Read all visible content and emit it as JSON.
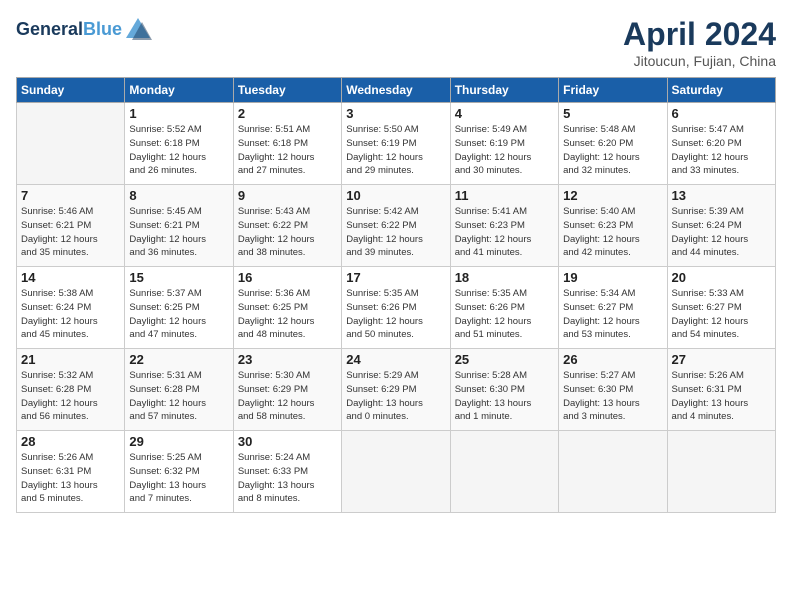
{
  "header": {
    "logo_line1": "General",
    "logo_line2": "Blue",
    "title": "April 2024",
    "subtitle": "Jitoucun, Fujian, China"
  },
  "weekdays": [
    "Sunday",
    "Monday",
    "Tuesday",
    "Wednesday",
    "Thursday",
    "Friday",
    "Saturday"
  ],
  "weeks": [
    [
      {
        "day": "",
        "info": ""
      },
      {
        "day": "1",
        "info": "Sunrise: 5:52 AM\nSunset: 6:18 PM\nDaylight: 12 hours\nand 26 minutes."
      },
      {
        "day": "2",
        "info": "Sunrise: 5:51 AM\nSunset: 6:18 PM\nDaylight: 12 hours\nand 27 minutes."
      },
      {
        "day": "3",
        "info": "Sunrise: 5:50 AM\nSunset: 6:19 PM\nDaylight: 12 hours\nand 29 minutes."
      },
      {
        "day": "4",
        "info": "Sunrise: 5:49 AM\nSunset: 6:19 PM\nDaylight: 12 hours\nand 30 minutes."
      },
      {
        "day": "5",
        "info": "Sunrise: 5:48 AM\nSunset: 6:20 PM\nDaylight: 12 hours\nand 32 minutes."
      },
      {
        "day": "6",
        "info": "Sunrise: 5:47 AM\nSunset: 6:20 PM\nDaylight: 12 hours\nand 33 minutes."
      }
    ],
    [
      {
        "day": "7",
        "info": "Sunrise: 5:46 AM\nSunset: 6:21 PM\nDaylight: 12 hours\nand 35 minutes."
      },
      {
        "day": "8",
        "info": "Sunrise: 5:45 AM\nSunset: 6:21 PM\nDaylight: 12 hours\nand 36 minutes."
      },
      {
        "day": "9",
        "info": "Sunrise: 5:43 AM\nSunset: 6:22 PM\nDaylight: 12 hours\nand 38 minutes."
      },
      {
        "day": "10",
        "info": "Sunrise: 5:42 AM\nSunset: 6:22 PM\nDaylight: 12 hours\nand 39 minutes."
      },
      {
        "day": "11",
        "info": "Sunrise: 5:41 AM\nSunset: 6:23 PM\nDaylight: 12 hours\nand 41 minutes."
      },
      {
        "day": "12",
        "info": "Sunrise: 5:40 AM\nSunset: 6:23 PM\nDaylight: 12 hours\nand 42 minutes."
      },
      {
        "day": "13",
        "info": "Sunrise: 5:39 AM\nSunset: 6:24 PM\nDaylight: 12 hours\nand 44 minutes."
      }
    ],
    [
      {
        "day": "14",
        "info": "Sunrise: 5:38 AM\nSunset: 6:24 PM\nDaylight: 12 hours\nand 45 minutes."
      },
      {
        "day": "15",
        "info": "Sunrise: 5:37 AM\nSunset: 6:25 PM\nDaylight: 12 hours\nand 47 minutes."
      },
      {
        "day": "16",
        "info": "Sunrise: 5:36 AM\nSunset: 6:25 PM\nDaylight: 12 hours\nand 48 minutes."
      },
      {
        "day": "17",
        "info": "Sunrise: 5:35 AM\nSunset: 6:26 PM\nDaylight: 12 hours\nand 50 minutes."
      },
      {
        "day": "18",
        "info": "Sunrise: 5:35 AM\nSunset: 6:26 PM\nDaylight: 12 hours\nand 51 minutes."
      },
      {
        "day": "19",
        "info": "Sunrise: 5:34 AM\nSunset: 6:27 PM\nDaylight: 12 hours\nand 53 minutes."
      },
      {
        "day": "20",
        "info": "Sunrise: 5:33 AM\nSunset: 6:27 PM\nDaylight: 12 hours\nand 54 minutes."
      }
    ],
    [
      {
        "day": "21",
        "info": "Sunrise: 5:32 AM\nSunset: 6:28 PM\nDaylight: 12 hours\nand 56 minutes."
      },
      {
        "day": "22",
        "info": "Sunrise: 5:31 AM\nSunset: 6:28 PM\nDaylight: 12 hours\nand 57 minutes."
      },
      {
        "day": "23",
        "info": "Sunrise: 5:30 AM\nSunset: 6:29 PM\nDaylight: 12 hours\nand 58 minutes."
      },
      {
        "day": "24",
        "info": "Sunrise: 5:29 AM\nSunset: 6:29 PM\nDaylight: 13 hours\nand 0 minutes."
      },
      {
        "day": "25",
        "info": "Sunrise: 5:28 AM\nSunset: 6:30 PM\nDaylight: 13 hours\nand 1 minute."
      },
      {
        "day": "26",
        "info": "Sunrise: 5:27 AM\nSunset: 6:30 PM\nDaylight: 13 hours\nand 3 minutes."
      },
      {
        "day": "27",
        "info": "Sunrise: 5:26 AM\nSunset: 6:31 PM\nDaylight: 13 hours\nand 4 minutes."
      }
    ],
    [
      {
        "day": "28",
        "info": "Sunrise: 5:26 AM\nSunset: 6:31 PM\nDaylight: 13 hours\nand 5 minutes."
      },
      {
        "day": "29",
        "info": "Sunrise: 5:25 AM\nSunset: 6:32 PM\nDaylight: 13 hours\nand 7 minutes."
      },
      {
        "day": "30",
        "info": "Sunrise: 5:24 AM\nSunset: 6:33 PM\nDaylight: 13 hours\nand 8 minutes."
      },
      {
        "day": "",
        "info": ""
      },
      {
        "day": "",
        "info": ""
      },
      {
        "day": "",
        "info": ""
      },
      {
        "day": "",
        "info": ""
      }
    ]
  ]
}
